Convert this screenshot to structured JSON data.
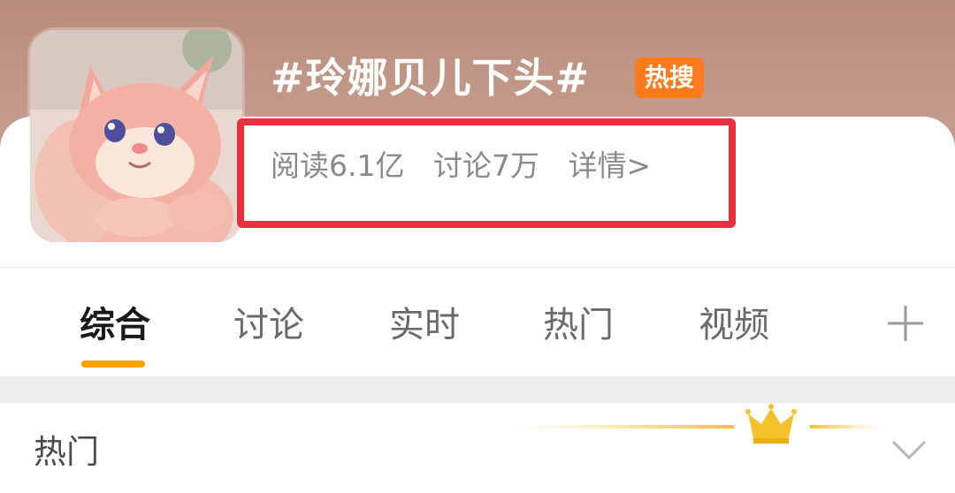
{
  "topic": {
    "title": "#玲娜贝儿下头#",
    "badge": "热搜"
  },
  "stats": {
    "reads": "阅读6.1亿",
    "discussions": "讨论7万",
    "details": "详情>"
  },
  "tabs": [
    {
      "label": "综合",
      "active": true
    },
    {
      "label": "讨论",
      "active": false
    },
    {
      "label": "实时",
      "active": false
    },
    {
      "label": "热门",
      "active": false
    },
    {
      "label": "视频",
      "active": false
    }
  ],
  "add_tab_icon": "plus-icon",
  "section": {
    "label": "热门",
    "decoration_icon": "crown-icon",
    "expand_icon": "chevron-down-icon"
  },
  "colors": {
    "accent": "#f7a400",
    "badge": "#ff7a1a",
    "highlight_box": "#e8303f"
  }
}
